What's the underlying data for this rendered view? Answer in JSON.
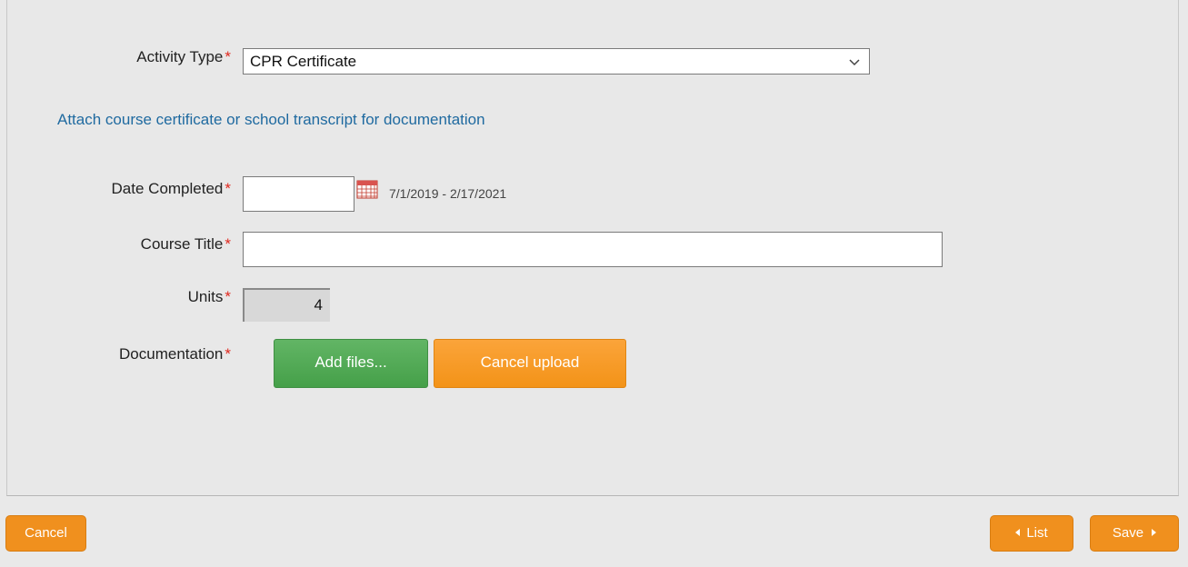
{
  "form": {
    "activity_type": {
      "label": "Activity Type",
      "required_mark": "*",
      "value": "CPR Certificate"
    },
    "info_text": "Attach course certificate or school transcript for documentation",
    "date_completed": {
      "label": "Date Completed",
      "required_mark": "*",
      "value": "",
      "range_hint": "7/1/2019 - 2/17/2021"
    },
    "course_title": {
      "label": "Course Title",
      "required_mark": "*",
      "value": ""
    },
    "units": {
      "label": "Units",
      "required_mark": "*",
      "value": "4"
    },
    "documentation": {
      "label": "Documentation",
      "required_mark": "*",
      "add_files_label": "Add files...",
      "cancel_upload_label": "Cancel upload"
    }
  },
  "footer": {
    "cancel_label": "Cancel",
    "list_label": "List",
    "save_label": "Save"
  },
  "colors": {
    "required": "#e0281e",
    "link": "#1f6aa0",
    "green_button": "#4caf50",
    "orange_button": "#f0901e"
  },
  "icons": {
    "select": "chevron-down-icon",
    "date": "calendar-icon",
    "list": "caret-left-icon",
    "save": "caret-right-icon"
  }
}
